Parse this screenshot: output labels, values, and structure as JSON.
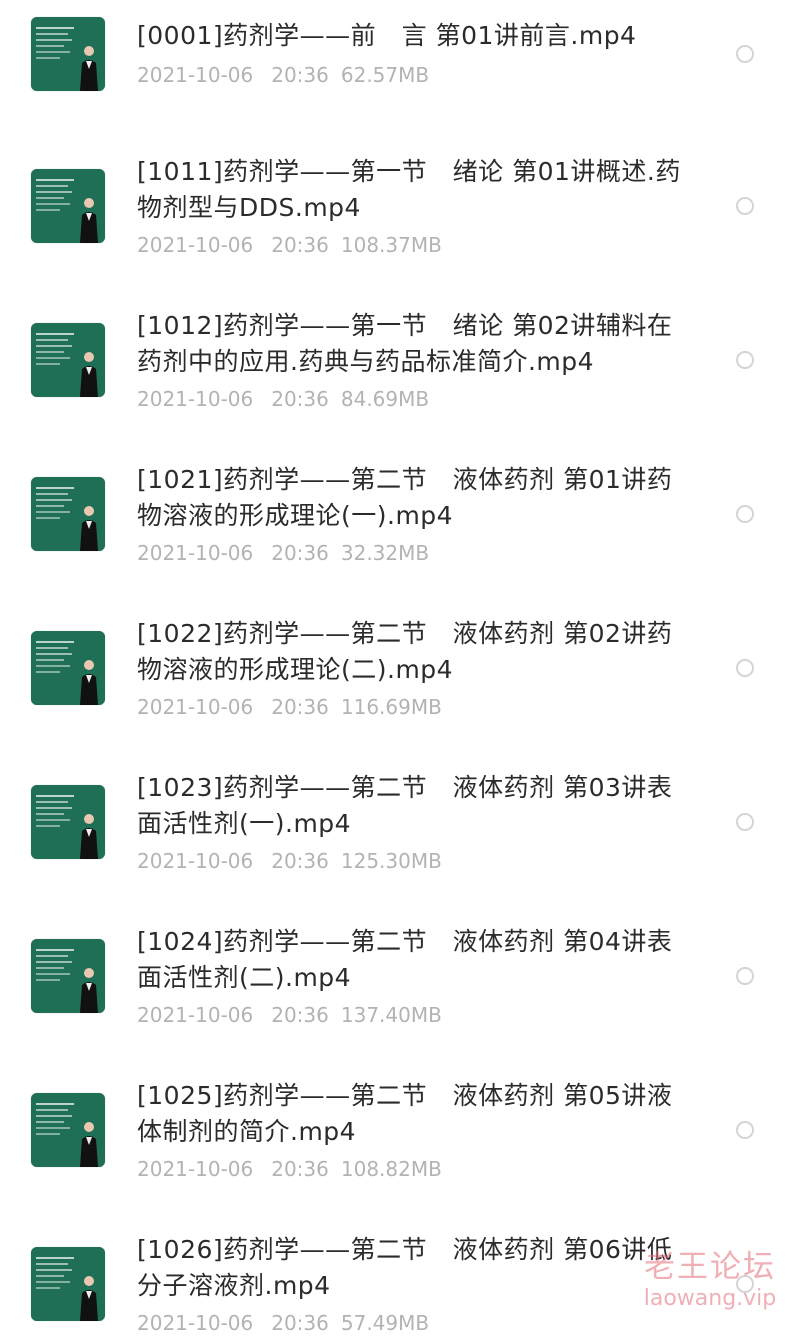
{
  "files": [
    {
      "name": "[0001]药剂学——前　言 第01讲前言.mp4",
      "date": "2021-10-06",
      "time": "20:36",
      "size": "62.57MB"
    },
    {
      "name": "[1011]药剂学——第一节　绪论 第01讲概述.药物剂型与DDS.mp4",
      "date": "2021-10-06",
      "time": "20:36",
      "size": "108.37MB"
    },
    {
      "name": "[1012]药剂学——第一节　绪论 第02讲辅料在药剂中的应用.药典与药品标准简介.mp4",
      "date": "2021-10-06",
      "time": "20:36",
      "size": "84.69MB"
    },
    {
      "name": "[1021]药剂学——第二节　液体药剂 第01讲药物溶液的形成理论(一).mp4",
      "date": "2021-10-06",
      "time": "20:36",
      "size": "32.32MB"
    },
    {
      "name": "[1022]药剂学——第二节　液体药剂 第02讲药物溶液的形成理论(二).mp4",
      "date": "2021-10-06",
      "time": "20:36",
      "size": "116.69MB"
    },
    {
      "name": "[1023]药剂学——第二节　液体药剂 第03讲表面活性剂(一).mp4",
      "date": "2021-10-06",
      "time": "20:36",
      "size": "125.30MB"
    },
    {
      "name": "[1024]药剂学——第二节　液体药剂 第04讲表面活性剂(二).mp4",
      "date": "2021-10-06",
      "time": "20:36",
      "size": "137.40MB"
    },
    {
      "name": "[1025]药剂学——第二节　液体药剂 第05讲液体制剂的简介.mp4",
      "date": "2021-10-06",
      "time": "20:36",
      "size": "108.82MB"
    },
    {
      "name": "[1026]药剂学——第二节　液体药剂 第06讲低分子溶液剂.mp4",
      "date": "2021-10-06",
      "time": "20:36",
      "size": "57.49MB"
    }
  ],
  "thumbnail_icon": "video-thumbnail-icon",
  "select_icon": "radio-unchecked-icon",
  "watermark": {
    "cn": "老王论坛",
    "en": "laowang.vip"
  },
  "colors": {
    "thumb_bg": "#1f6f57",
    "title": "#2b2b2b",
    "meta": "#b3b3b3",
    "watermark": "#e16e78"
  }
}
